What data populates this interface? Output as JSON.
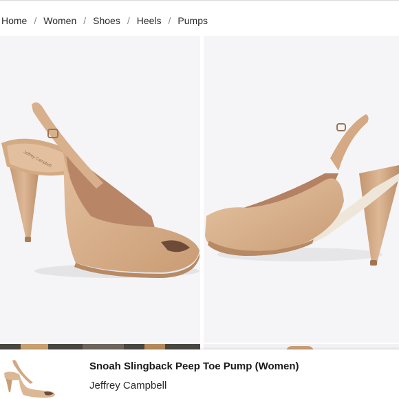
{
  "breadcrumb": {
    "items": [
      "Home",
      "Women",
      "Shoes",
      "Heels",
      "Pumps"
    ],
    "separator": "/"
  },
  "product": {
    "title": "Snoah Slingback Peep Toe Pump (Women)",
    "brand": "Jeffrey Campbell",
    "insole_imprint": "Jeffrey Campbell"
  },
  "colors": {
    "page_bg": "#ffffff",
    "image_bg": "#f5f5f7",
    "shoe_leather": "#d9b28e",
    "shoe_shadow": "#c69b74",
    "inner_lining": "#b88466"
  }
}
